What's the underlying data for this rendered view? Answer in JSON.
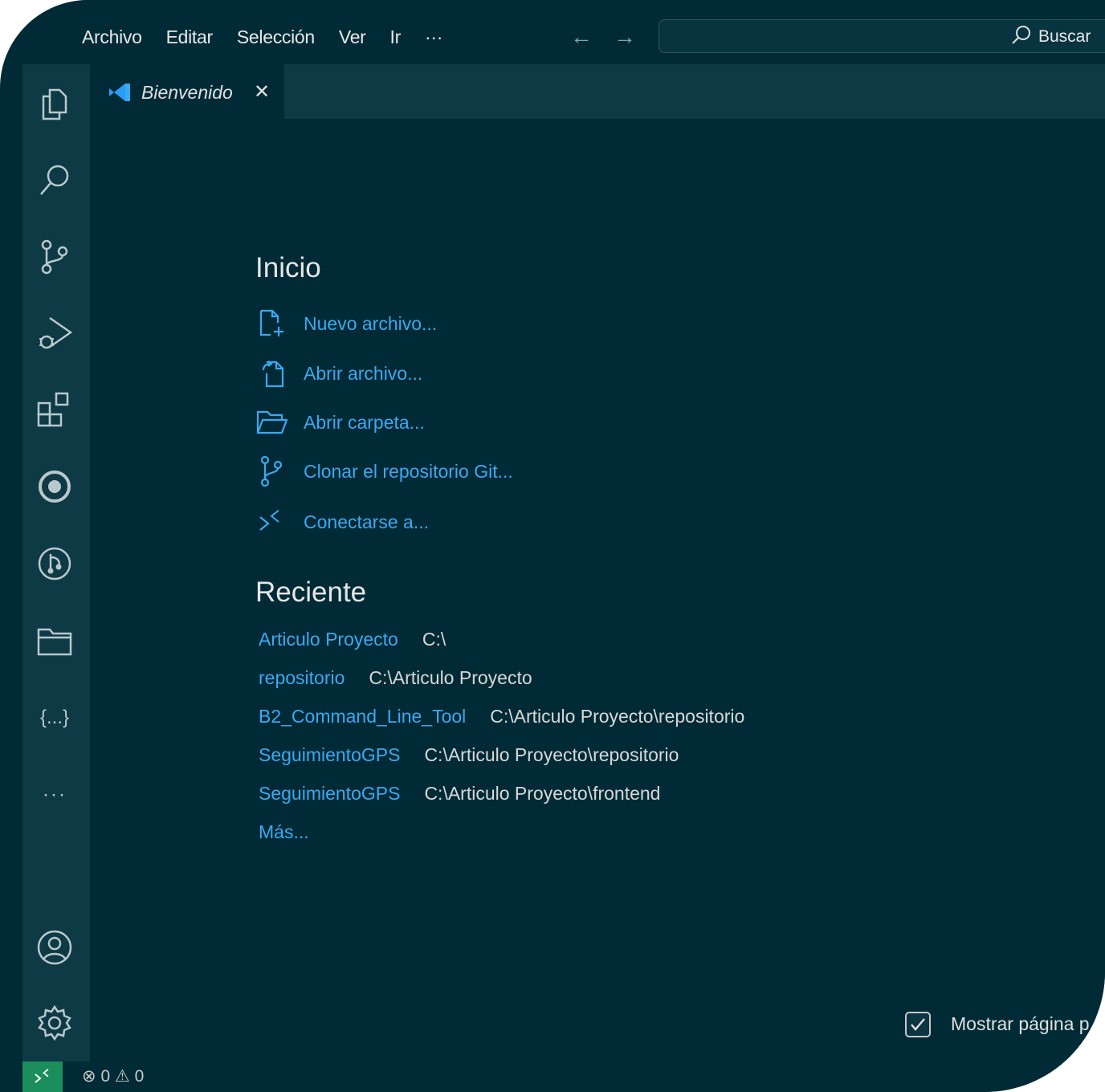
{
  "menu": {
    "items": [
      "Archivo",
      "Editar",
      "Selección",
      "Ver",
      "Ir",
      "···"
    ],
    "back": "←",
    "forward": "→"
  },
  "search": {
    "label": "Buscar"
  },
  "activity_bar": {
    "icons": [
      "explorer-icon",
      "search-icon",
      "source-control-icon",
      "run-debug-icon",
      "extensions-icon",
      "target-icon",
      "git-graph-icon",
      "folder-icon",
      "json-icon",
      "more-icon",
      "account-icon",
      "settings-icon"
    ],
    "more_label": "···",
    "json_label": "{...}"
  },
  "tab": {
    "label": "Bienvenido",
    "close": "✕"
  },
  "welcome": {
    "start_title": "Inicio",
    "start_items": [
      {
        "label": "Nuevo archivo...",
        "icon": "new-file-icon"
      },
      {
        "label": "Abrir archivo...",
        "icon": "open-file-icon"
      },
      {
        "label": "Abrir carpeta...",
        "icon": "open-folder-icon"
      },
      {
        "label": "Clonar el repositorio Git...",
        "icon": "git-clone-icon"
      },
      {
        "label": "Conectarse a...",
        "icon": "remote-connect-icon"
      }
    ],
    "recent_title": "Reciente",
    "recent_items": [
      {
        "name": "Articulo Proyecto",
        "path": "C:\\"
      },
      {
        "name": "repositorio",
        "path": "C:\\Articulo Proyecto"
      },
      {
        "name": "B2_Command_Line_Tool",
        "path": "C:\\Articulo Proyecto\\repositorio"
      },
      {
        "name": "SeguimientoGPS",
        "path": "C:\\Articulo Proyecto\\repositorio"
      },
      {
        "name": "SeguimientoGPS",
        "path": "C:\\Articulo Proyecto\\frontend"
      }
    ],
    "more_label": "Más...",
    "show_on_startup_label": "Mostrar página p",
    "show_on_startup_checked": true
  },
  "status": {
    "errors": "0",
    "warnings": "0"
  },
  "colors": {
    "background": "#002b36",
    "activity_bar": "#0d3a45",
    "link": "#3fa7f0",
    "remote": "#1a8f5c"
  }
}
